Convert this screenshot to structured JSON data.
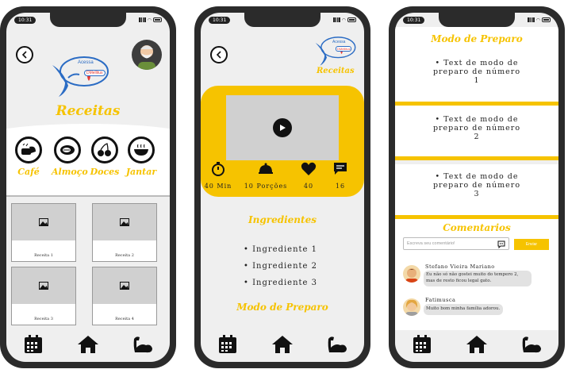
{
  "status": {
    "time": "10:31"
  },
  "screen1": {
    "logo_text": "Acessa",
    "logo_badge": "DMellitus",
    "title": "Receitas",
    "categories": [
      {
        "label": "Café",
        "icon": "bread-icon"
      },
      {
        "label": "Almoço",
        "icon": "steak-icon"
      },
      {
        "label": "Doces",
        "icon": "cherries-icon"
      },
      {
        "label": "Jantar",
        "icon": "soup-bowl-icon"
      }
    ],
    "recipes": [
      "Receita 1",
      "Receita 2",
      "Receita 3",
      "Receita 4"
    ]
  },
  "screen2": {
    "logo_text": "Acessa",
    "logo_badge": "DMellitus",
    "logo_caption": "Receitas",
    "stats": [
      {
        "value": "40 Min",
        "icon": "timer-icon"
      },
      {
        "value": "10 Porções",
        "icon": "serving-dish-icon"
      },
      {
        "value": "40",
        "icon": "heart-icon"
      },
      {
        "value": "16",
        "icon": "comment-icon"
      }
    ],
    "ingredients_title": "Ingredientes",
    "ingredients": [
      "Ingrediente 1",
      "Ingrediente 2",
      "Ingrediente 3"
    ],
    "method_title": "Modo de Preparo"
  },
  "screen3": {
    "method_title": "Modo de Preparo",
    "steps": [
      [
        "• Text de modo de",
        "preparo de número",
        "1"
      ],
      [
        "• Text de modo de",
        "preparo de número",
        "2"
      ],
      [
        "• Text de modo de",
        "preparo de número",
        "3"
      ]
    ],
    "comments_title": "Comentarios",
    "comment_placeholder": "Escreva seu comentário!",
    "send_label": "Enviar",
    "comments": [
      {
        "name": "Stefano Vieira Mariano",
        "line1": "Eu não só não gostei muito do tempero 2,",
        "line2": "mas de resto ficou legal gato."
      },
      {
        "name": "Fatimusca",
        "line1": "Muito bom minha família adorou.",
        "line2": ""
      }
    ]
  },
  "nav": {
    "icons": [
      "calendar-icon",
      "home-icon",
      "muscle-icon"
    ]
  },
  "colors": {
    "accent": "#f6c300",
    "logo_blue": "#2b6cc4",
    "logo_red": "#e53935"
  }
}
